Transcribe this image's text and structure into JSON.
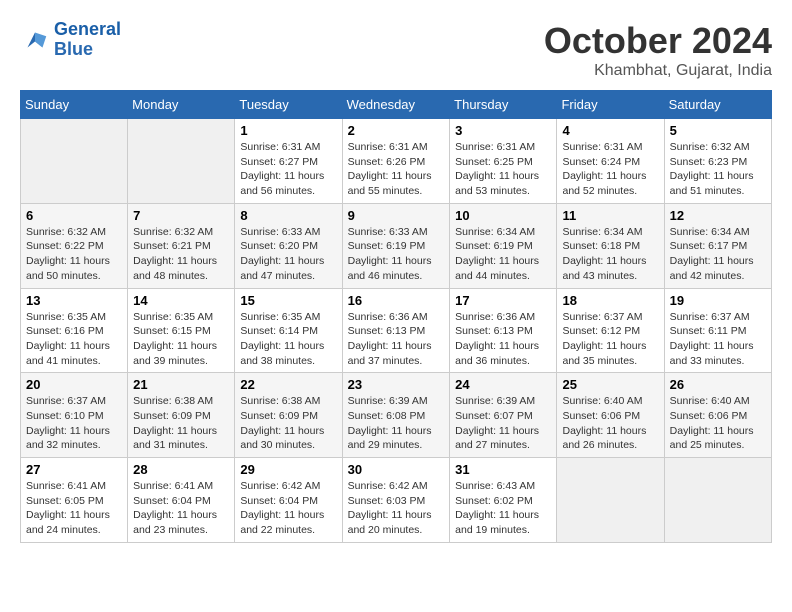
{
  "header": {
    "logo_line1": "General",
    "logo_line2": "Blue",
    "month": "October 2024",
    "location": "Khambhat, Gujarat, India"
  },
  "days_of_week": [
    "Sunday",
    "Monday",
    "Tuesday",
    "Wednesday",
    "Thursday",
    "Friday",
    "Saturday"
  ],
  "weeks": [
    [
      {
        "day": "",
        "info": ""
      },
      {
        "day": "",
        "info": ""
      },
      {
        "day": "1",
        "info": "Sunrise: 6:31 AM\nSunset: 6:27 PM\nDaylight: 11 hours and 56 minutes."
      },
      {
        "day": "2",
        "info": "Sunrise: 6:31 AM\nSunset: 6:26 PM\nDaylight: 11 hours and 55 minutes."
      },
      {
        "day": "3",
        "info": "Sunrise: 6:31 AM\nSunset: 6:25 PM\nDaylight: 11 hours and 53 minutes."
      },
      {
        "day": "4",
        "info": "Sunrise: 6:31 AM\nSunset: 6:24 PM\nDaylight: 11 hours and 52 minutes."
      },
      {
        "day": "5",
        "info": "Sunrise: 6:32 AM\nSunset: 6:23 PM\nDaylight: 11 hours and 51 minutes."
      }
    ],
    [
      {
        "day": "6",
        "info": "Sunrise: 6:32 AM\nSunset: 6:22 PM\nDaylight: 11 hours and 50 minutes."
      },
      {
        "day": "7",
        "info": "Sunrise: 6:32 AM\nSunset: 6:21 PM\nDaylight: 11 hours and 48 minutes."
      },
      {
        "day": "8",
        "info": "Sunrise: 6:33 AM\nSunset: 6:20 PM\nDaylight: 11 hours and 47 minutes."
      },
      {
        "day": "9",
        "info": "Sunrise: 6:33 AM\nSunset: 6:19 PM\nDaylight: 11 hours and 46 minutes."
      },
      {
        "day": "10",
        "info": "Sunrise: 6:34 AM\nSunset: 6:19 PM\nDaylight: 11 hours and 44 minutes."
      },
      {
        "day": "11",
        "info": "Sunrise: 6:34 AM\nSunset: 6:18 PM\nDaylight: 11 hours and 43 minutes."
      },
      {
        "day": "12",
        "info": "Sunrise: 6:34 AM\nSunset: 6:17 PM\nDaylight: 11 hours and 42 minutes."
      }
    ],
    [
      {
        "day": "13",
        "info": "Sunrise: 6:35 AM\nSunset: 6:16 PM\nDaylight: 11 hours and 41 minutes."
      },
      {
        "day": "14",
        "info": "Sunrise: 6:35 AM\nSunset: 6:15 PM\nDaylight: 11 hours and 39 minutes."
      },
      {
        "day": "15",
        "info": "Sunrise: 6:35 AM\nSunset: 6:14 PM\nDaylight: 11 hours and 38 minutes."
      },
      {
        "day": "16",
        "info": "Sunrise: 6:36 AM\nSunset: 6:13 PM\nDaylight: 11 hours and 37 minutes."
      },
      {
        "day": "17",
        "info": "Sunrise: 6:36 AM\nSunset: 6:13 PM\nDaylight: 11 hours and 36 minutes."
      },
      {
        "day": "18",
        "info": "Sunrise: 6:37 AM\nSunset: 6:12 PM\nDaylight: 11 hours and 35 minutes."
      },
      {
        "day": "19",
        "info": "Sunrise: 6:37 AM\nSunset: 6:11 PM\nDaylight: 11 hours and 33 minutes."
      }
    ],
    [
      {
        "day": "20",
        "info": "Sunrise: 6:37 AM\nSunset: 6:10 PM\nDaylight: 11 hours and 32 minutes."
      },
      {
        "day": "21",
        "info": "Sunrise: 6:38 AM\nSunset: 6:09 PM\nDaylight: 11 hours and 31 minutes."
      },
      {
        "day": "22",
        "info": "Sunrise: 6:38 AM\nSunset: 6:09 PM\nDaylight: 11 hours and 30 minutes."
      },
      {
        "day": "23",
        "info": "Sunrise: 6:39 AM\nSunset: 6:08 PM\nDaylight: 11 hours and 29 minutes."
      },
      {
        "day": "24",
        "info": "Sunrise: 6:39 AM\nSunset: 6:07 PM\nDaylight: 11 hours and 27 minutes."
      },
      {
        "day": "25",
        "info": "Sunrise: 6:40 AM\nSunset: 6:06 PM\nDaylight: 11 hours and 26 minutes."
      },
      {
        "day": "26",
        "info": "Sunrise: 6:40 AM\nSunset: 6:06 PM\nDaylight: 11 hours and 25 minutes."
      }
    ],
    [
      {
        "day": "27",
        "info": "Sunrise: 6:41 AM\nSunset: 6:05 PM\nDaylight: 11 hours and 24 minutes."
      },
      {
        "day": "28",
        "info": "Sunrise: 6:41 AM\nSunset: 6:04 PM\nDaylight: 11 hours and 23 minutes."
      },
      {
        "day": "29",
        "info": "Sunrise: 6:42 AM\nSunset: 6:04 PM\nDaylight: 11 hours and 22 minutes."
      },
      {
        "day": "30",
        "info": "Sunrise: 6:42 AM\nSunset: 6:03 PM\nDaylight: 11 hours and 20 minutes."
      },
      {
        "day": "31",
        "info": "Sunrise: 6:43 AM\nSunset: 6:02 PM\nDaylight: 11 hours and 19 minutes."
      },
      {
        "day": "",
        "info": ""
      },
      {
        "day": "",
        "info": ""
      }
    ]
  ]
}
